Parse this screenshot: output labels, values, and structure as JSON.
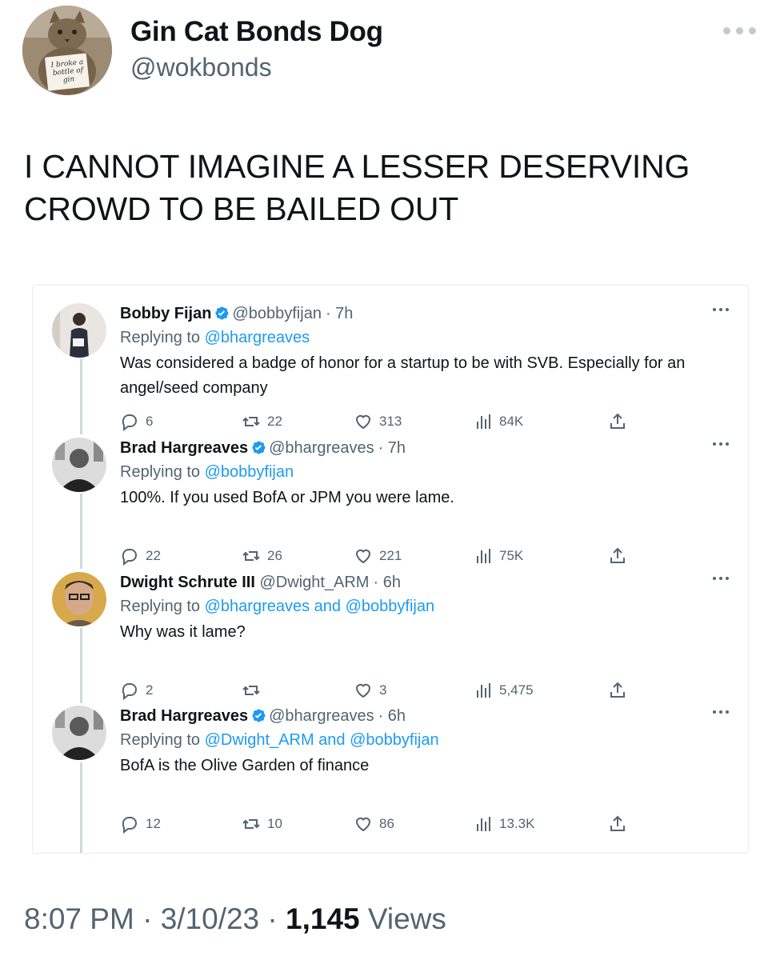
{
  "author": {
    "name": "Gin Cat Bonds Dog",
    "handle": "@wokbonds",
    "avatar_sign": "I broke a bottle of gin"
  },
  "tweet": {
    "text_line1": "I CANNOT IMAGINE A LESSER DESERVING",
    "text_line2": "CROWD TO BE BAILED OUT"
  },
  "replies": [
    {
      "name": "Bobby Fijan",
      "verified": true,
      "handle": "@bobbyfijan",
      "time": "· 7h",
      "replying_prefix": "Replying to",
      "replying_to": "@bhargreaves",
      "body": "Was considered a badge of honor for a startup to be with SVB. Especially for an angel/seed company",
      "replies_count": "6",
      "retweets": "22",
      "likes": "313",
      "views": "84K"
    },
    {
      "name": "Brad Hargreaves",
      "verified": true,
      "handle": "@bhargreaves",
      "time": "· 7h",
      "replying_prefix": "Replying to",
      "replying_to": "@bobbyfijan",
      "body": "100%. If you used BofA or JPM you were lame.",
      "replies_count": "22",
      "retweets": "26",
      "likes": "221",
      "views": "75K"
    },
    {
      "name": "Dwight Schrute III",
      "verified": false,
      "handle": "@Dwight_ARM",
      "time": "· 6h",
      "replying_prefix": "Replying to",
      "replying_to": "@bhargreaves and @bobbyfijan",
      "body": "Why was it lame?",
      "replies_count": "2",
      "retweets": "",
      "likes": "3",
      "views": "5,475"
    },
    {
      "name": "Brad Hargreaves",
      "verified": true,
      "handle": "@bhargreaves",
      "time": "· 6h",
      "replying_prefix": "Replying to",
      "replying_to": "@Dwight_ARM and @bobbyfijan",
      "body": "BofA is the Olive Garden of finance",
      "replies_count": "12",
      "retweets": "10",
      "likes": "86",
      "views": "13.3K"
    }
  ],
  "footer": {
    "time": "8:07 PM",
    "sep1": " · ",
    "date": "3/10/23",
    "sep2": " · ",
    "views_count": "1,145",
    "views_label": " Views"
  },
  "colors": {
    "link": "#1d9bf0",
    "muted": "#536471",
    "text": "#0f1419",
    "verified": "#1d9bf0"
  },
  "icons": [
    "more-icon",
    "verified-icon",
    "reply-icon",
    "retweet-icon",
    "like-icon",
    "views-icon",
    "share-icon"
  ]
}
